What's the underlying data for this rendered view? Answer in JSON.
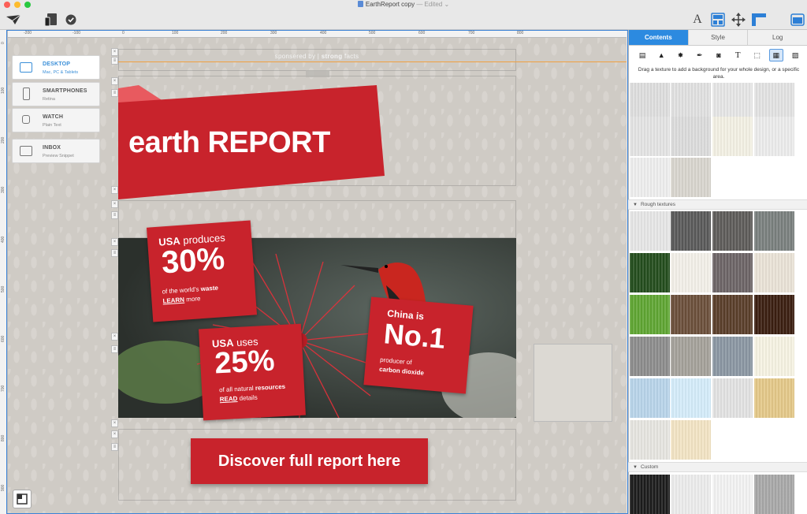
{
  "window": {
    "title": "EarthReport copy",
    "status": "— Edited ⌄"
  },
  "ruler": {
    "top_ticks": [
      "-200",
      "-100",
      "0",
      "100",
      "200",
      "300",
      "400",
      "500",
      "600",
      "700",
      "800"
    ],
    "left_ticks": [
      "0",
      "100",
      "200",
      "300",
      "400",
      "500",
      "600",
      "700",
      "800",
      "900"
    ]
  },
  "devices": [
    {
      "name": "DESKTOP",
      "sub": "Mac, PC & Tablets",
      "active": true
    },
    {
      "name": "SMARTPHONES",
      "sub": "Retina",
      "active": false
    },
    {
      "name": "WATCH",
      "sub": "Plain Text",
      "active": false
    },
    {
      "name": "INBOX",
      "sub": "Preview Snippet",
      "active": false
    }
  ],
  "design": {
    "sponsor_prefix": "sponsered by",
    "sponsor_bold": "strong",
    "sponsor_suffix": "facts",
    "title": "earth REPORT",
    "card1": {
      "line1_bold": "USA",
      "line1_rest": "produces",
      "big": "30%",
      "line3": "of the world's",
      "line3_bold": "waste",
      "link": "LEARN",
      "link_rest": "more"
    },
    "card2": {
      "line1_bold": "USA",
      "line1_rest": "uses",
      "big": "25%",
      "line3": "of all natural",
      "line3_bold": "resources",
      "link": "READ",
      "link_rest": "details"
    },
    "card3": {
      "line1": "China is",
      "big": "No.1",
      "line3": "producer of",
      "line4": "carbon dioxide"
    },
    "cta": "Discover full report here"
  },
  "panel": {
    "tabs": [
      "Contents",
      "Style",
      "Log"
    ],
    "active_tab": "Contents",
    "hint": "Drag a texture to add a background for your whole design, or a specific area.",
    "sections": [
      "Rough textures",
      "Custom"
    ],
    "colors": {
      "accent": "#2c8ae0",
      "brand_red": "#c8232c"
    }
  }
}
